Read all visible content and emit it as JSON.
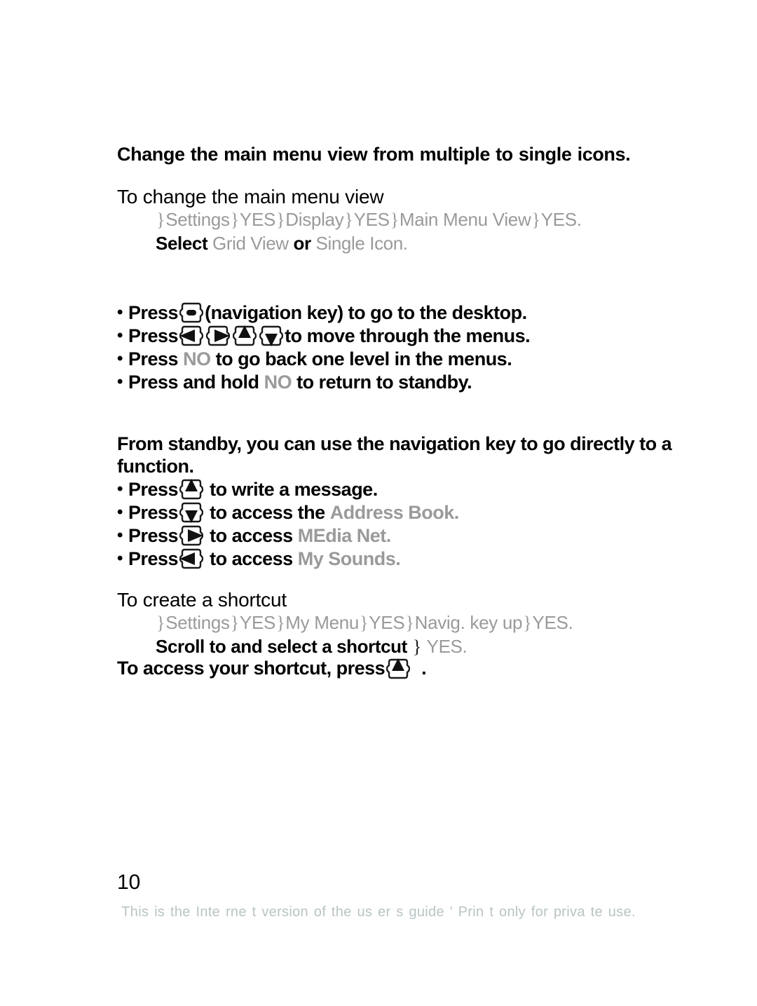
{
  "intro": {
    "text": "Change the main menu view from multiple to single icons."
  },
  "sections": [
    {
      "heading": "To change the main menu view",
      "path": {
        "items": [
          "Settings",
          "YES",
          "Display",
          "YES",
          "Main Menu View",
          "YES"
        ],
        "separator": "}"
      },
      "select_line": {
        "verb": "Select",
        "option_a": "Grid View",
        "conjunction": "or",
        "option_b": "Single Icon",
        "terminator": "."
      }
    },
    {
      "heading": "To create a shortcut",
      "path": {
        "items": [
          "Settings",
          "YES",
          "My Menu",
          "YES",
          "Navig. key up",
          "YES"
        ],
        "separator": "}"
      },
      "select_line": {
        "verb": "Scroll to and select a shortcut",
        "separator": "}",
        "confirm": "YES"
      }
    }
  ],
  "nav_bullets": [
    {
      "prefix": "Press",
      "icon": "navkey-center-icon",
      "suffix": "(navigation key) to go to the desktop."
    },
    {
      "prefix": "Press",
      "icons": [
        "navkey-left-icon",
        "navkey-right-icon",
        "navkey-up-icon",
        "navkey-down-icon"
      ],
      "suffix": "to move through the menus."
    },
    {
      "prefix": "Press",
      "key_label": "NO",
      "suffix": "to go back one level in the menus."
    },
    {
      "prefix": "Press and hold",
      "key_label": "NO",
      "suffix": "to return to standby."
    }
  ],
  "standby_paragraph": "From standby, you can use the navigation key to go directly to a function.",
  "standby_bullets": [
    {
      "prefix": "Press",
      "icon": "navkey-up-icon",
      "mid": "to write a message.",
      "target": ""
    },
    {
      "prefix": "Press",
      "icon": "navkey-down-icon",
      "mid": "to access the",
      "target": "Address Book",
      "terminator": "."
    },
    {
      "prefix": "Press",
      "icon": "navkey-right-icon",
      "mid": "to access",
      "target": "MEdia Net",
      "terminator": "."
    },
    {
      "prefix": "Press",
      "icon": "navkey-left-icon",
      "mid": "to access",
      "target": "My Sounds",
      "terminator": "."
    }
  ],
  "closing_line": {
    "prefix": "To access your shortcut, press",
    "icon": "navkey-up-icon",
    "terminator": "."
  },
  "footer": {
    "page_number": "10",
    "note": "This is  the Inte rne t version  of the us er s guide  ' Prin  t only for priva  te use."
  },
  "colors": {
    "text": "#000000",
    "gray_ui_term": "#9a9a9a",
    "footer": "#b9c4c4",
    "background": "#ffffff"
  }
}
